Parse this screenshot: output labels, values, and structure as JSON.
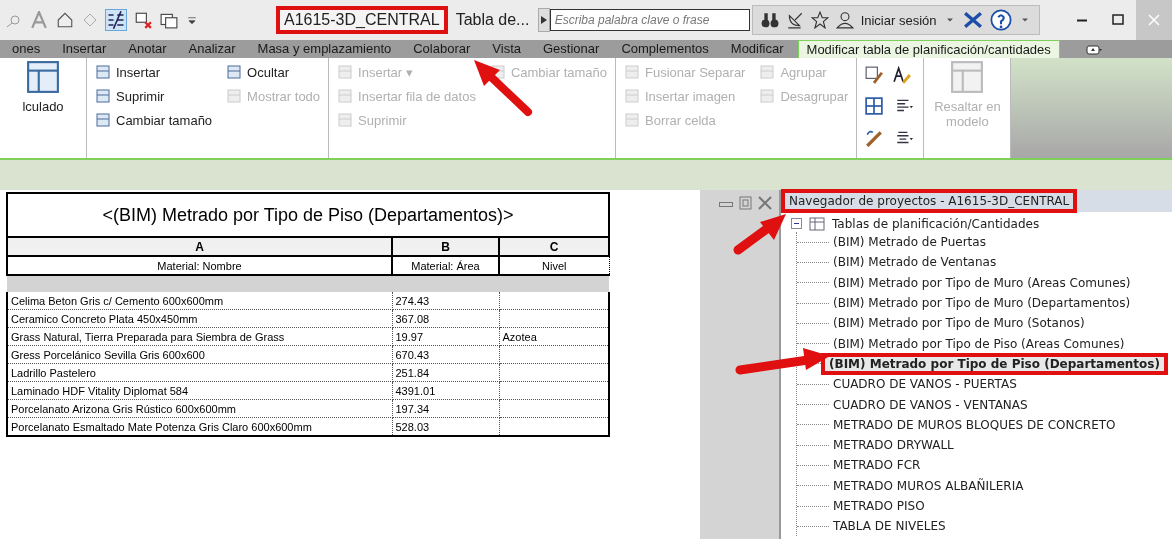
{
  "title_bar": {
    "file": "A1615-3D_CENTRAL",
    "view": "Tabla de...",
    "search": {
      "placeholder": "Escriba palabra clave o frase"
    },
    "sign_in": "Iniciar sesión"
  },
  "ribbon_tabs": [
    {
      "label": "ones",
      "selected": false
    },
    {
      "label": "Insertar",
      "selected": false
    },
    {
      "label": "Anotar",
      "selected": false
    },
    {
      "label": "Analizar",
      "selected": false
    },
    {
      "label": "Masa y emplazamiento",
      "selected": false
    },
    {
      "label": "Colaborar",
      "selected": false
    },
    {
      "label": "Vista",
      "selected": false
    },
    {
      "label": "Gestionar",
      "selected": false
    },
    {
      "label": "Complementos",
      "selected": false
    },
    {
      "label": "Modificar",
      "selected": false
    },
    {
      "label": "Modificar tabla de planificación/cantidades",
      "selected": true
    }
  ],
  "ribbon_panels": [
    {
      "kind": "big",
      "items": [
        {
          "label": "lculado",
          "disabled": false
        }
      ]
    },
    {
      "kind": "columns",
      "columns": [
        [
          {
            "label": "Insertar",
            "disabled": false
          },
          {
            "label": "Suprimir",
            "disabled": false
          },
          {
            "label": "Cambiar tamaño",
            "disabled": false
          }
        ],
        [
          {
            "label": "Ocultar",
            "disabled": false
          },
          {
            "label": "Mostrar todo",
            "disabled": true
          }
        ]
      ]
    },
    {
      "kind": "columns",
      "columns": [
        [
          {
            "label": "Insertar ▾",
            "disabled": true
          },
          {
            "label": "Insertar fila de datos",
            "disabled": true
          },
          {
            "label": "Suprimir",
            "disabled": true
          }
        ],
        [
          {
            "label": "Cambiar tamaño",
            "disabled": true
          }
        ]
      ]
    },
    {
      "kind": "columns",
      "columns": [
        [
          {
            "label": "Fusionar  Separar",
            "disabled": true
          },
          {
            "label": "Insertar  imagen",
            "disabled": true
          },
          {
            "label": "Borrar  celda",
            "disabled": true
          }
        ],
        [
          {
            "label": "Agrupar",
            "disabled": true
          },
          {
            "label": "Desagrupar",
            "disabled": true
          }
        ]
      ]
    },
    {
      "kind": "format"
    },
    {
      "kind": "big",
      "items": [
        {
          "label": "Resaltar en modelo",
          "disabled": true
        }
      ]
    }
  ],
  "schedule": {
    "title": "<(BIM) Metrado por Tipo de Piso (Departamentos)>",
    "column_letters": [
      "A",
      "B",
      "C"
    ],
    "headers": [
      "Material: Nombre",
      "Material: Área",
      "Nivel"
    ],
    "rows": [
      [
        "Celima Beton Gris c/ Cemento 600x600mm",
        "274.43",
        ""
      ],
      [
        "Ceramico Concreto Plata 450x450mm",
        "367.08",
        ""
      ],
      [
        "Grass Natural, Tierra Preparada para Siembra de Grass",
        "19.97",
        "Azotea"
      ],
      [
        "Gress Porcelánico Sevilla Gris 600x600",
        "670.43",
        ""
      ],
      [
        "Ladrillo Pastelero",
        "251.84",
        ""
      ],
      [
        "Laminado HDF Vitality Diplomat 584",
        "4391.01",
        ""
      ],
      [
        "Porcelanato Arizona Gris Rústico 600x600mm",
        "197.34",
        ""
      ],
      [
        "Porcelanato Esmaltado Mate Potenza Gris Claro 600x600mm",
        "528.03",
        ""
      ]
    ]
  },
  "project_browser": {
    "title": "Navegador de proyectos - A1615-3D_CENTRAL",
    "root": {
      "label": "Tablas de planificación/Cantidades",
      "expanded": true,
      "children": [
        {
          "label": "(BIM) Metrado de Puertas",
          "selected": false
        },
        {
          "label": "(BIM) Metrado de Ventanas",
          "selected": false
        },
        {
          "label": "(BIM) Metrado por Tipo de Muro (Areas Comunes)",
          "selected": false
        },
        {
          "label": "(BIM) Metrado por Tipo de Muro (Departamentos)",
          "selected": false
        },
        {
          "label": "(BIM) Metrado por Tipo de Muro (Sotanos)",
          "selected": false
        },
        {
          "label": "(BIM) Metrado por Tipo de Piso (Areas Comunes)",
          "selected": false
        },
        {
          "label": "(BIM) Metrado por Tipo de Piso (Departamentos)",
          "selected": true
        },
        {
          "label": "CUADRO DE VANOS - PUERTAS",
          "selected": false
        },
        {
          "label": "CUADRO DE VANOS - VENTANAS",
          "selected": false
        },
        {
          "label": "METRADO DE MUROS BLOQUES DE CONCRETO",
          "selected": false
        },
        {
          "label": "METRADO DRYWALL",
          "selected": false
        },
        {
          "label": "METRADO FCR",
          "selected": false
        },
        {
          "label": "METRADO MUROS ALBAÑILERIA",
          "selected": false
        },
        {
          "label": "METRADO PISO",
          "selected": false
        },
        {
          "label": "TABLA DE NIVELES",
          "selected": false
        }
      ]
    }
  }
}
